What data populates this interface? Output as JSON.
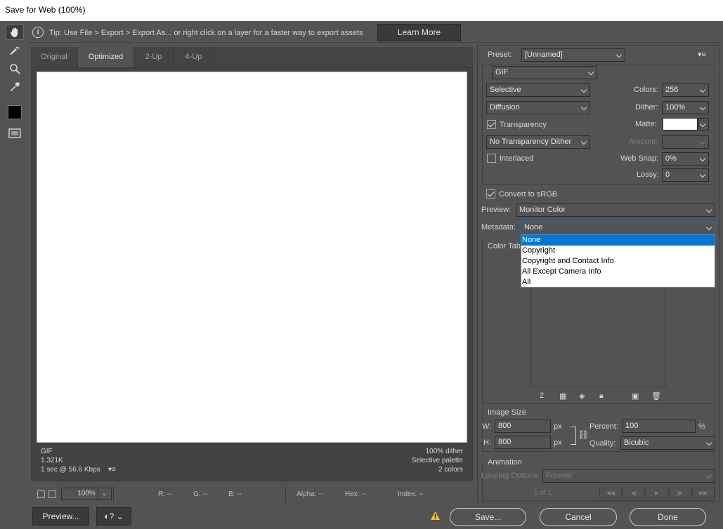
{
  "window": {
    "title": "Save for Web (100%)"
  },
  "tip": {
    "text": "Tip: Use File > Export > Export As...  or right click on a layer for a faster way to export assets",
    "learn_more": "Learn More"
  },
  "tabs": [
    "Original",
    "Optimized",
    "2-Up",
    "4-Up"
  ],
  "image_info": {
    "format": "GIF",
    "size": "1.321K",
    "time": "1 sec @ 56.6 Kbps",
    "dither": "100% dither",
    "palette": "Selective palette",
    "colors": "2 colors"
  },
  "status": {
    "zoom": "100%",
    "r": "R: --",
    "g": "G: --",
    "b": "B: --",
    "alpha": "Alpha: --",
    "hex": "Hex: --",
    "index": "Index: --"
  },
  "bottom_buttons": {
    "preview": "Preview...",
    "save": "Save...",
    "cancel": "Cancel",
    "done": "Done"
  },
  "settings": {
    "preset_label": "Preset:",
    "preset_value": "[Unnamed]",
    "format": "GIF",
    "reduction": "Selective",
    "dither_algo": "Diffusion",
    "transparency_label": "Transparency",
    "transparency_dither": "No Transparency Dither",
    "interlaced_label": "Interlaced",
    "colors_label": "Colors:",
    "colors_value": "256",
    "dither_label": "Dither:",
    "dither_value": "100%",
    "matte_label": "Matte:",
    "amount_label": "Amount:",
    "websnap_label": "Web Snap:",
    "websnap_value": "0%",
    "lossy_label": "Lossy:",
    "lossy_value": "0",
    "convert_srgb_label": "Convert to sRGB",
    "preview_label": "Preview:",
    "preview_value": "Monitor Color",
    "metadata_label": "Metadata:",
    "metadata_value": "None",
    "metadata_options": [
      "None",
      "Copyright",
      "Copyright and Contact Info",
      "All Except Camera Info",
      "All"
    ],
    "color_table_label": "Color Table",
    "color_count": "2"
  },
  "image_size": {
    "title": "Image Size",
    "w_label": "W:",
    "w_value": "800",
    "h_label": "H:",
    "h_value": "800",
    "unit": "px",
    "percent_label": "Percent:",
    "percent_value": "100",
    "percent_unit": "%",
    "quality_label": "Quality:",
    "quality_value": "Bicubic"
  },
  "animation": {
    "title": "Animation",
    "looping_label": "Looping Options:",
    "looping_value": "Forever",
    "frame": "1 of 1"
  }
}
